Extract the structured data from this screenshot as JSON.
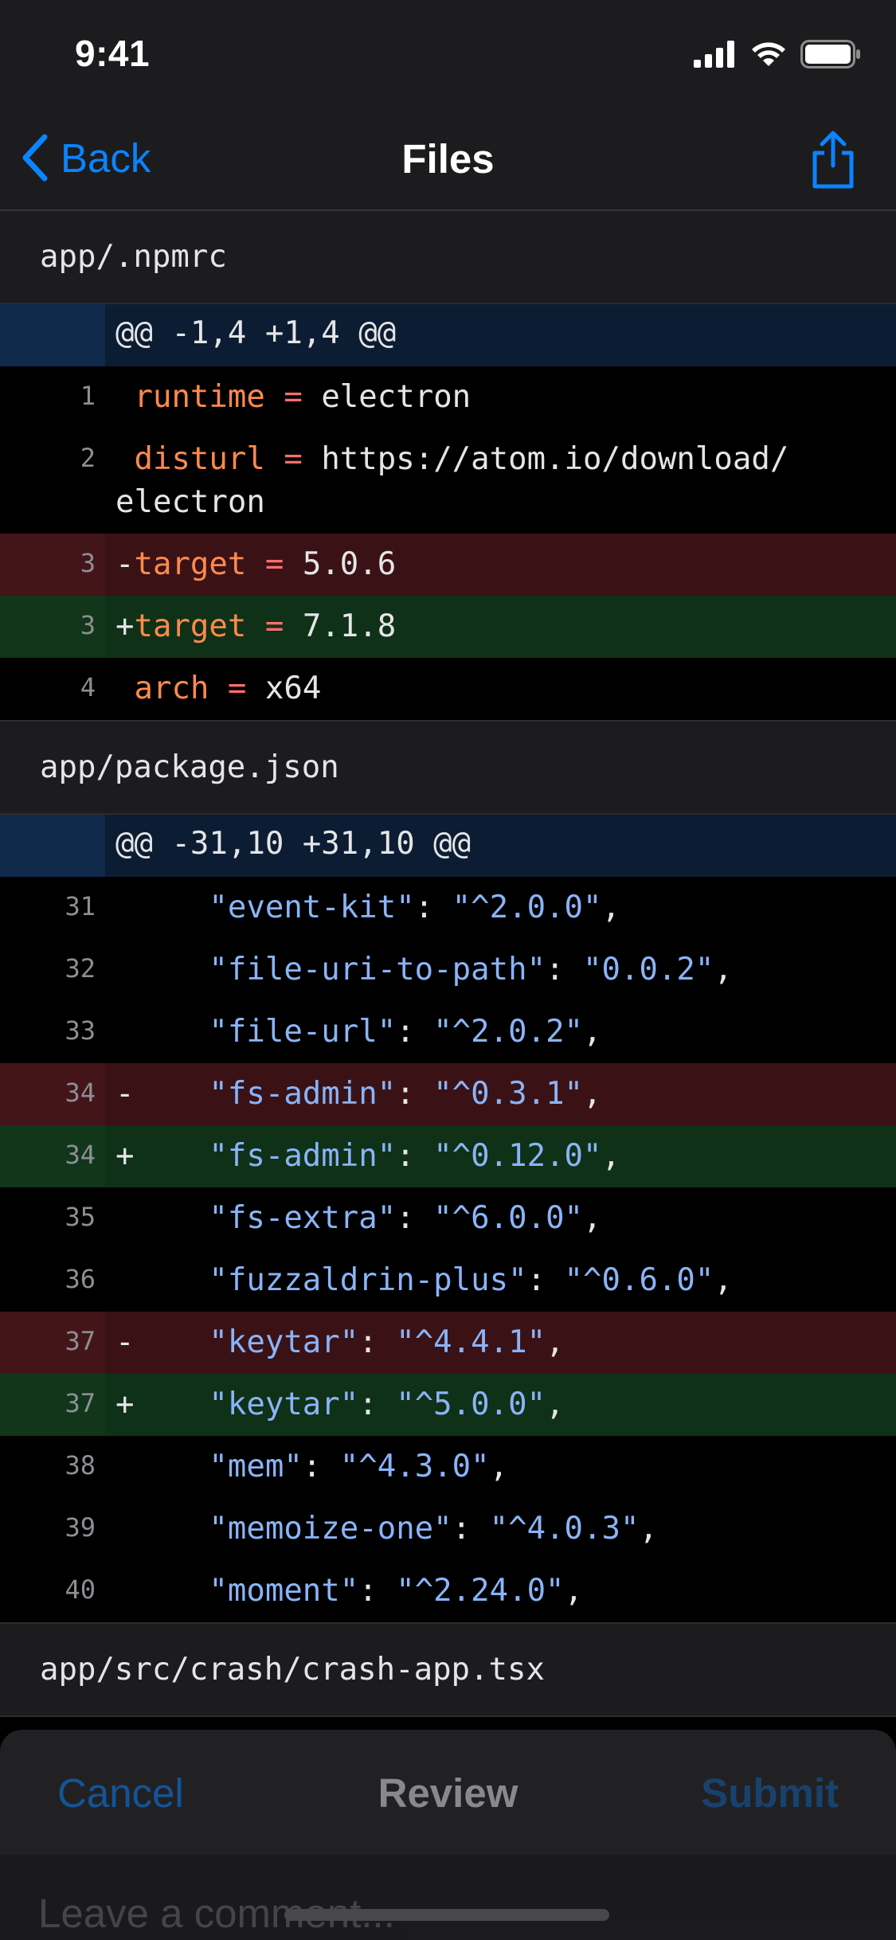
{
  "status_bar": {
    "time": "9:41"
  },
  "nav": {
    "back_label": "Back",
    "title": "Files"
  },
  "files": [
    {
      "path": "app/.npmrc",
      "hunk": "@@ -1,4 +1,4 @@",
      "lines": [
        {
          "num": "1",
          "type": "ctx",
          "prefix": " ",
          "key": "runtime",
          "sep": " = ",
          "val": "electron",
          "kind": "ini"
        },
        {
          "num": "2",
          "type": "ctx",
          "prefix": " ",
          "key": "disturl",
          "sep": " = ",
          "val": "https://atom.io/download/\nelectron",
          "kind": "ini"
        },
        {
          "num": "3",
          "type": "del",
          "prefix": "-",
          "key": "target",
          "sep": " = ",
          "val": "5.0.6",
          "kind": "ini"
        },
        {
          "num": "3",
          "type": "add",
          "prefix": "+",
          "key": "target",
          "sep": " = ",
          "val": "7.1.8",
          "kind": "ini"
        },
        {
          "num": "4",
          "type": "ctx",
          "prefix": " ",
          "key": "arch",
          "sep": " = ",
          "val": "x64",
          "kind": "ini"
        }
      ]
    },
    {
      "path": "app/package.json",
      "hunk": "@@ -31,10 +31,10 @@",
      "lines": [
        {
          "num": "31",
          "type": "ctx",
          "prefix": " ",
          "key": "\"event-kit\"",
          "sep": ": ",
          "val": "\"^2.0.0\"",
          "tail": ",",
          "kind": "json"
        },
        {
          "num": "32",
          "type": "ctx",
          "prefix": " ",
          "key": "\"file-uri-to-path\"",
          "sep": ": ",
          "val": "\"0.0.2\"",
          "tail": ",",
          "kind": "json"
        },
        {
          "num": "33",
          "type": "ctx",
          "prefix": " ",
          "key": "\"file-url\"",
          "sep": ": ",
          "val": "\"^2.0.2\"",
          "tail": ",",
          "kind": "json"
        },
        {
          "num": "34",
          "type": "del",
          "prefix": "-",
          "key": "\"fs-admin\"",
          "sep": ": ",
          "val": "\"^0.3.1\"",
          "tail": ",",
          "kind": "json"
        },
        {
          "num": "34",
          "type": "add",
          "prefix": "+",
          "key": "\"fs-admin\"",
          "sep": ": ",
          "val": "\"^0.12.0\"",
          "tail": ",",
          "kind": "json"
        },
        {
          "num": "35",
          "type": "ctx",
          "prefix": " ",
          "key": "\"fs-extra\"",
          "sep": ": ",
          "val": "\"^6.0.0\"",
          "tail": ",",
          "kind": "json"
        },
        {
          "num": "36",
          "type": "ctx",
          "prefix": " ",
          "key": "\"fuzzaldrin-plus\"",
          "sep": ": ",
          "val": "\"^0.6.0\"",
          "tail": ",",
          "kind": "json"
        },
        {
          "num": "37",
          "type": "del",
          "prefix": "-",
          "key": "\"keytar\"",
          "sep": ": ",
          "val": "\"^4.4.1\"",
          "tail": ",",
          "kind": "json"
        },
        {
          "num": "37",
          "type": "add",
          "prefix": "+",
          "key": "\"keytar\"",
          "sep": ": ",
          "val": "\"^5.0.0\"",
          "tail": ",",
          "kind": "json"
        },
        {
          "num": "38",
          "type": "ctx",
          "prefix": " ",
          "key": "\"mem\"",
          "sep": ": ",
          "val": "\"^4.3.0\"",
          "tail": ",",
          "kind": "json"
        },
        {
          "num": "39",
          "type": "ctx",
          "prefix": " ",
          "key": "\"memoize-one\"",
          "sep": ": ",
          "val": "\"^4.0.3\"",
          "tail": ",",
          "kind": "json"
        },
        {
          "num": "40",
          "type": "ctx",
          "prefix": " ",
          "key": "\"moment\"",
          "sep": ": ",
          "val": "\"^2.24.0\"",
          "tail": ",",
          "kind": "json"
        }
      ]
    },
    {
      "path": "app/src/crash/crash-app.tsx",
      "hunk": "",
      "lines": []
    }
  ],
  "review": {
    "cancel_label": "Cancel",
    "title": "Review",
    "submit_label": "Submit",
    "comment_placeholder": "Leave a comment..."
  },
  "colors": {
    "accent": "#0a84ff",
    "added_bg": "#0f3117",
    "removed_bg": "#3a1216",
    "hunk_bg": "#0c1d33",
    "key": "#ff8a4c",
    "string": "#8ab4f8"
  },
  "icons": {
    "back": "chevron-left-icon",
    "share": "share-icon",
    "signal": "cellular-signal-icon",
    "wifi": "wifi-icon",
    "battery": "battery-icon"
  }
}
